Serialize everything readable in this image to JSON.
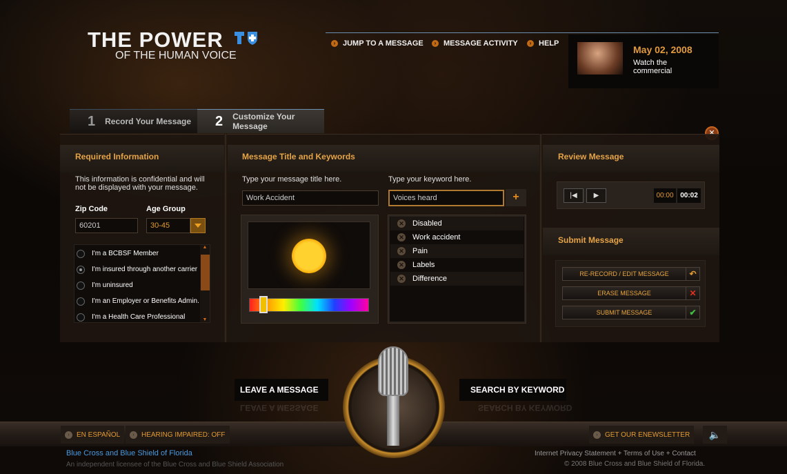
{
  "logo": {
    "line1": "THE POWER",
    "line2": "OF THE HUMAN VOICE"
  },
  "nav": [
    {
      "label": "JUMP TO A MESSAGE"
    },
    {
      "label": "MESSAGE ACTIVITY"
    },
    {
      "label": "HELP"
    }
  ],
  "promo": {
    "date": "May 02, 2008",
    "text": "Watch the commercial"
  },
  "tabs": [
    {
      "num": "1",
      "label": "Record Your Message"
    },
    {
      "num": "2",
      "label": "Customize Your Message"
    }
  ],
  "required": {
    "heading": "Required Information",
    "note": "This information is confidential and will not be displayed with your message.",
    "zip_label": "Zip Code",
    "zip_value": "60201",
    "age_label": "Age Group",
    "age_value": "30-45",
    "options": [
      {
        "label": "I'm a BCBSF Member"
      },
      {
        "label": "I'm insured through another carrier"
      },
      {
        "label": "I'm uninsured"
      },
      {
        "label": "I'm an Employer or Benefits Admin."
      },
      {
        "label": "I'm a Health Care Professional"
      }
    ],
    "selected_option": "I'm insured through another carrier"
  },
  "title_kw": {
    "heading": "Message Title and Keywords",
    "title_prompt": "Type your message title here.",
    "title_value": "Work Accident",
    "kw_prompt": "Type your keyword here.",
    "kw_value": "Voices heard",
    "plus": "+",
    "keywords": [
      "Disabled",
      "Work accident",
      "Pain",
      "Labels",
      "Difference"
    ],
    "color_level": 0.12
  },
  "review": {
    "heading": "Review Message",
    "elapsed": "00:00",
    "total": "00:02"
  },
  "submit": {
    "heading": "Submit Message",
    "buttons": [
      {
        "label": "RE-RECORD / EDIT MESSAGE",
        "icon": "undo-icon"
      },
      {
        "label": "ERASE MESSAGE",
        "icon": "close-icon"
      },
      {
        "label": "SUBMIT MESSAGE",
        "icon": "check-icon"
      }
    ]
  },
  "actions": {
    "leave": "LEAVE A MESSAGE",
    "search": "SEARCH BY KEYWORD"
  },
  "footer": {
    "espanol": "EN ESPAÑOL",
    "hearing": "HEARING IMPAIRED: OFF",
    "newsletter": "GET OUR ENEWSLETTER",
    "brand": "Blue Cross and Blue Shield of Florida",
    "licensee": "An independent licensee of the Blue Cross and Blue Shield Association",
    "links": "Internet Privacy Statement  +  Terms of Use  +  Contact",
    "copyright": "© 2008 Blue Cross and Blue Shield of Florida."
  },
  "colors": {
    "accent": "#e6a446",
    "nav_line": "#6b8fb0",
    "erase": "#e03020",
    "submit": "#40c040"
  }
}
